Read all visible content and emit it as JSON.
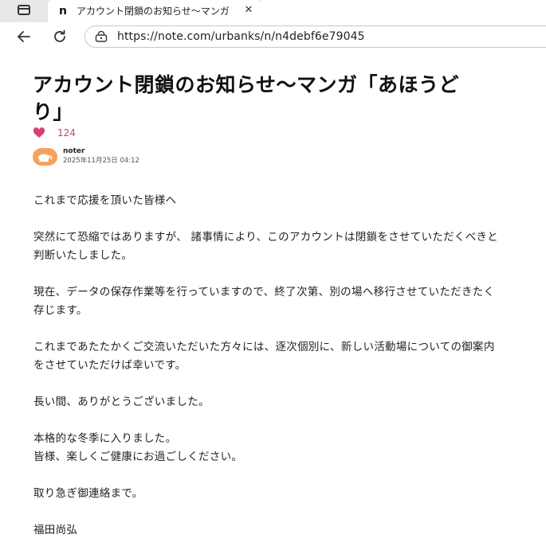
{
  "browser": {
    "tab": {
      "favicon_letter": "n",
      "title": "アカウント閉鎖のお知らせ〜マンガ「あほうどり」",
      "close_glyph": "✕"
    },
    "url": "https://note.com/urbanks/n/n4debf6e79045"
  },
  "article": {
    "title": "アカウント閉鎖のお知らせ〜マンガ「あほうどり」",
    "likes": "124",
    "author": {
      "name": "noter",
      "date": "2025年11月25日 04:12"
    },
    "paragraphs": [
      "これまで応援を頂いた皆様へ",
      "突然にて恐縮ではありますが、 諸事情により、このアカウントは閉鎖をさせていただくべきと判断いたしました。",
      "現在、データの保存作業等を行っていますので、終了次第、別の場へ移行させていただきたく存じます。",
      "これまであたたかくご交流いただいた方々には、逐次個別に、新しい活動場についての御案内をさせていただけば幸いです。",
      "長い間、ありがとうございました。",
      "本格的な冬季に入りました。\n皆様、楽しくご健康にお過ごしください。",
      "取り急ぎ御連絡まで。",
      "福田尚弘"
    ]
  },
  "colors": {
    "heart": "#d8426f",
    "avatar": "#f4a25b"
  },
  "icons": [
    "tab-panel-icon",
    "back-arrow-icon",
    "reload-icon",
    "site-info-icon",
    "heart-icon",
    "avatar-icon"
  ]
}
